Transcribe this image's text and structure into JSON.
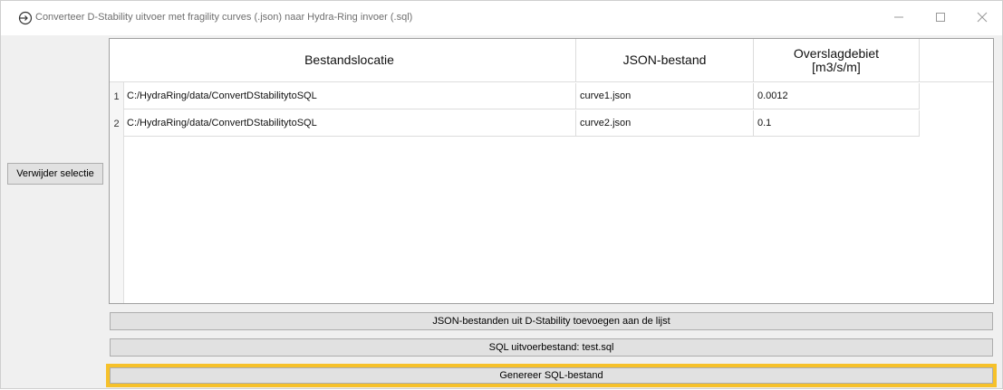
{
  "window": {
    "title": "Converteer D-Stability uitvoer met fragility curves (.json) naar Hydra-Ring invoer (.sql)",
    "icon": "arrow-in-circle-icon",
    "controls": [
      "minimize-icon",
      "maximize-icon",
      "close-icon"
    ]
  },
  "left_panel": {
    "remove_button_label": "Verwijder selectie"
  },
  "table": {
    "columns": [
      {
        "label": "Bestandslocatie"
      },
      {
        "label": "JSON-bestand"
      },
      {
        "label_line1": "Overslagdebiet",
        "label_line2": "[m3/s/m]"
      }
    ],
    "rows": [
      {
        "num": "1",
        "location": "C:/HydraRing/data/ConvertDStabilitytoSQL",
        "json": "curve1.json",
        "debiet": "0.0012"
      },
      {
        "num": "2",
        "location": "C:/HydraRing/data/ConvertDStabilitytoSQL",
        "json": "curve2.json",
        "debiet": "0.1"
      }
    ]
  },
  "actions": {
    "add_json_label": "JSON-bestanden uit D-Stability toevoegen aan de lijst",
    "sql_output_label": "SQL uitvoerbestand: test.sql",
    "generate_label": "Genereer SQL-bestand"
  },
  "colors": {
    "highlight": "#f6c12a",
    "button_face": "#e1e1e1",
    "window_bg": "#f0f0f0"
  }
}
